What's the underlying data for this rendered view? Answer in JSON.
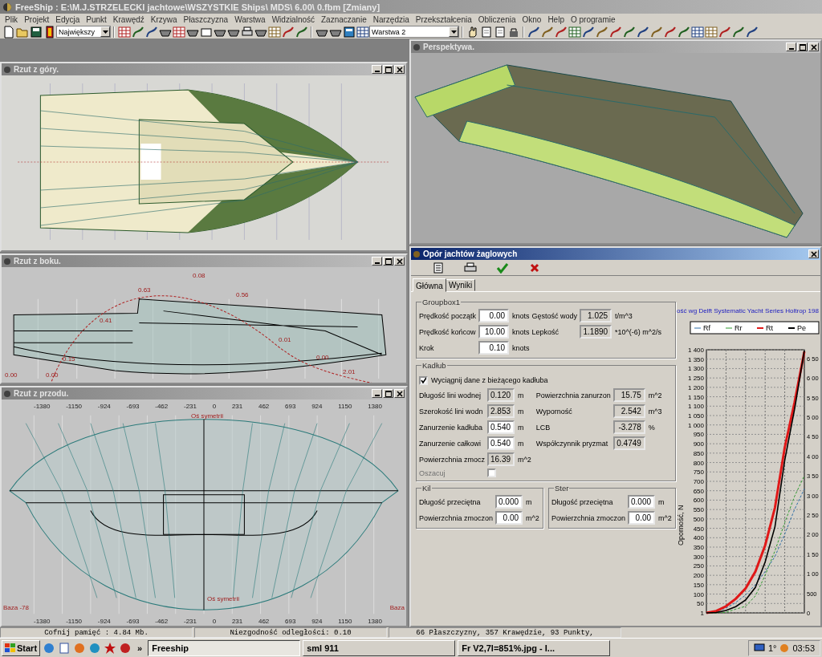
{
  "window": {
    "title": "FreeShip : E:\\M.J.STRZELECKI jachtowe\\WSZYSTKIE Ships\\ MDS\\ 6.00\\ 0.fbm [Zmiany]"
  },
  "menu": [
    "Plik",
    "Projekt",
    "Edycja",
    "Punkt",
    "Krawędź",
    "Krzywa",
    "Płaszczyzna",
    "Warstwa",
    "Widzialność",
    "Zaznaczanie",
    "Narzędzia",
    "Przekształcenia",
    "Obliczenia",
    "Okno",
    "Help",
    "O programie"
  ],
  "toolbar": {
    "zoom_combo": "Największy",
    "layer_combo": "Warstwa 2"
  },
  "views": {
    "top": {
      "title": "Rzut z góry."
    },
    "perspective": {
      "title": "Perspektywa."
    },
    "side": {
      "title": "Rzut z boku.",
      "curve_labels": [
        "0.08",
        "0.63",
        "0.56",
        "0.41",
        "0.15",
        "0.00",
        "0.01",
        "0.00",
        "0.00",
        "2.01"
      ]
    },
    "front": {
      "title": "Rzut z przodu.",
      "top_ticks": [
        "-1380",
        "-1150",
        "-924",
        "-693",
        "-462",
        "-231",
        "0",
        "231",
        "462",
        "693",
        "924",
        "1150",
        "1380"
      ],
      "axis_label_top": "Oś symetrii",
      "bottom_ticks": [
        "-1380",
        "-1150",
        "-924",
        "-693",
        "-462",
        "-231",
        "0",
        "231",
        "462",
        "693",
        "924",
        "1150",
        "1380"
      ],
      "axis_label_bottom": "Oś symetrii",
      "baseline_left": "Baza -78",
      "baseline_right": "Baza"
    }
  },
  "dialog": {
    "title": "Opór jachtów żaglowych",
    "tabs": [
      {
        "label": "Główna",
        "selected": true
      },
      {
        "label": "Wyniki",
        "selected": false
      }
    ],
    "groupbox1": {
      "title": "Groupbox1",
      "rows": [
        {
          "label": "Prędkość początk",
          "value": "0.00",
          "unit": "knots",
          "label2": "Gęstość wody",
          "value2": "1.025",
          "unit2": "t/m^3"
        },
        {
          "label": "Prędkość końcow",
          "value": "10.00",
          "unit": "knots",
          "label2": "Lepkość",
          "value2": "1.1890",
          "unit2": "*10^(-6) m^2/s"
        },
        {
          "label": "Krok",
          "value": "0.10",
          "unit": "knots"
        }
      ]
    },
    "hull": {
      "title": "Kadłub",
      "checkbox": {
        "label": "Wyciągnij dane z bieżącego kadłuba",
        "checked": true
      },
      "left_fields": [
        {
          "label": "Długość lini wodnej",
          "value": "0.120",
          "unit": "m",
          "readonly": true
        },
        {
          "label": "Szerokość lini wodn",
          "value": "2.853",
          "unit": "m",
          "readonly": true
        },
        {
          "label": "Zanurzenie kadłuba",
          "value": "0.540",
          "unit": "m",
          "readonly": false
        },
        {
          "label": "Zanurzenie całkowi",
          "value": "0.540",
          "unit": "m",
          "readonly": false
        },
        {
          "label": "Powierzchnia zmocz",
          "value": "16.39",
          "unit": "m^2",
          "readonly": true
        }
      ],
      "right_fields": [
        {
          "label": "Powierzchnia zanurzon",
          "value": "15.75",
          "unit": "m^2",
          "readonly": true
        },
        {
          "label": "Wyporność",
          "value": "2.542",
          "unit": "m^3",
          "readonly": true
        },
        {
          "label": "LCB",
          "value": "-3.278",
          "unit": "%",
          "readonly": true
        },
        {
          "label": "Współczynnik pryzmat",
          "value": "0.4749",
          "readonly": true
        }
      ],
      "estimate": {
        "label": "Oszacuj",
        "disabled": true,
        "checked": false
      }
    },
    "keel": {
      "title": "Kil",
      "fields": [
        {
          "label": "Długość przeciętna",
          "value": "0.000",
          "unit": "m"
        },
        {
          "label": "Powierzchnia zmoczon",
          "value": "0.00",
          "unit": "m^2"
        }
      ]
    },
    "rudder": {
      "title": "Ster",
      "fields": [
        {
          "label": "Długość przeciętna",
          "value": "0.000",
          "unit": "m"
        },
        {
          "label": "Powierzchnia zmoczon",
          "value": "0.00",
          "unit": "m^2"
        }
      ]
    },
    "chart": {
      "chart_data": {
        "type": "line",
        "title": "ość wg Delft Systematic Yacht Series Holtrop 198",
        "ylabel": "Oporność, N",
        "ylim": [
          0,
          1400
        ],
        "yticks": [
          {
            "value": 1,
            "label": "1"
          },
          {
            "value": 50,
            "label": "50"
          },
          {
            "value": 100,
            "label": "100"
          },
          {
            "value": 150,
            "label": "150"
          },
          {
            "value": 200,
            "label": "200"
          },
          {
            "value": 250,
            "label": "250"
          },
          {
            "value": 300,
            "label": "300"
          },
          {
            "value": 350,
            "label": "350"
          },
          {
            "value": 400,
            "label": "400"
          },
          {
            "value": 450,
            "label": "450"
          },
          {
            "value": 500,
            "label": "500"
          },
          {
            "value": 550,
            "label": "550"
          },
          {
            "value": 600,
            "label": "600"
          },
          {
            "value": 650,
            "label": "650"
          },
          {
            "value": 700,
            "label": "700"
          },
          {
            "value": 750,
            "label": "750"
          },
          {
            "value": 800,
            "label": "800"
          },
          {
            "value": 850,
            "label": "850"
          },
          {
            "value": 900,
            "label": "900"
          },
          {
            "value": 950,
            "label": "950"
          },
          {
            "value": 1000,
            "label": "1 000"
          },
          {
            "value": 1050,
            "label": "1 050"
          },
          {
            "value": 1100,
            "label": "1 100"
          },
          {
            "value": 1150,
            "label": "1 150"
          },
          {
            "value": 1200,
            "label": "1 200"
          },
          {
            "value": 1250,
            "label": "1 250"
          },
          {
            "value": 1300,
            "label": "1 300"
          },
          {
            "value": 1350,
            "label": "1 350"
          },
          {
            "value": 1400,
            "label": "1 400"
          }
        ],
        "y2lim": [
          0,
          6720
        ],
        "grid": true,
        "legend": true,
        "y2ticks": [
          {
            "value": 0,
            "label": "0"
          },
          {
            "value": 500,
            "label": "500"
          },
          {
            "value": 1000,
            "label": "1 00"
          },
          {
            "value": 1500,
            "label": "1 50"
          },
          {
            "value": 2000,
            "label": "2 00"
          },
          {
            "value": 2500,
            "label": "2 50"
          },
          {
            "value": 3000,
            "label": "3 00"
          },
          {
            "value": 3500,
            "label": "3 50"
          },
          {
            "value": 4000,
            "label": "4 00"
          },
          {
            "value": 4500,
            "label": "4 50"
          },
          {
            "value": 5000,
            "label": "5 00"
          },
          {
            "value": 5500,
            "label": "5 50"
          },
          {
            "value": 6000,
            "label": "6 00"
          },
          {
            "value": 6500,
            "label": "6 50"
          }
        ],
        "series": [
          {
            "name": "Rf",
            "color": "#2f6fa8",
            "line_style": "dashed",
            "values": [
              0,
              8,
              25,
              55,
              95,
              150,
              220,
              300,
              420,
              550,
              660
            ]
          },
          {
            "name": "Rr",
            "color": "#2f9a2f",
            "line_style": "dashed",
            "values": [
              0,
              0,
              3,
              20,
              35,
              90,
              200,
              330,
              480,
              620,
              730
            ]
          },
          {
            "name": "Rt",
            "color": "#e01818",
            "values": [
              0,
              10,
              35,
              75,
              130,
              220,
              360,
              560,
              880,
              1120,
              1390
            ]
          },
          {
            "name": "Pe",
            "color": "#000000",
            "axis": "y2",
            "values": [
              0,
              10,
              60,
              160,
              330,
              650,
              1300,
              2200,
              3900,
              5200,
              6700
            ]
          }
        ]
      }
    }
  },
  "status_bar": [
    "Cofnij pamięć : 4.84 Mb.",
    "Niezgodność odległości: 0.10",
    "66 Płaszczyzny, 357 Krawędzie, 93 Punkty,"
  ],
  "taskbar": {
    "start": "Start",
    "more": "»",
    "tasks": [
      {
        "label": "Freeship",
        "selected": true
      },
      {
        "label": "sml 911",
        "selected": false
      },
      {
        "label": "Fr V2,7l=851%.jpg - I...",
        "selected": false
      }
    ],
    "tray_text": "1°",
    "clock": "03:53"
  }
}
